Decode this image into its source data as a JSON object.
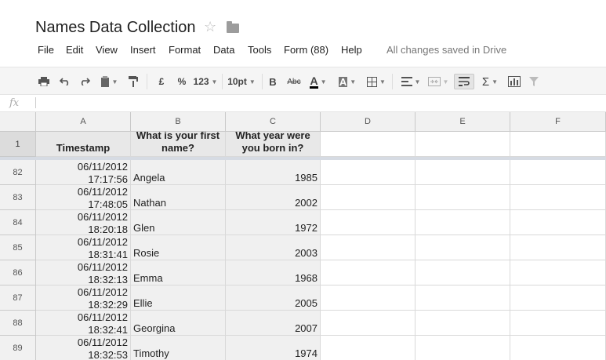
{
  "doc": {
    "title": "Names Data Collection"
  },
  "menu": {
    "items": [
      "File",
      "Edit",
      "View",
      "Insert",
      "Format",
      "Data",
      "Tools",
      "Form (88)",
      "Help"
    ],
    "status": "All changes saved in Drive"
  },
  "toolbar": {
    "currency": "£",
    "percent": "%",
    "number_format": "123",
    "font_size": "10pt",
    "bold": "B",
    "strikethrough": "Abc",
    "text_color": "A",
    "fill_color": "A",
    "sum": "Σ"
  },
  "formula_bar": {
    "fx": "fx",
    "value": ""
  },
  "columns": [
    "A",
    "B",
    "C",
    "D",
    "E",
    "F"
  ],
  "header_row": {
    "row_number": "1",
    "a": "Timestamp",
    "b": "What is your first name?",
    "c": "What year were you born in?"
  },
  "rows": [
    {
      "num": "82",
      "date": "06/11/2012",
      "time": "17:17:56",
      "name": "Angela",
      "year": "1985"
    },
    {
      "num": "83",
      "date": "06/11/2012",
      "time": "17:48:05",
      "name": "Nathan",
      "year": "2002"
    },
    {
      "num": "84",
      "date": "06/11/2012",
      "time": "18:20:18",
      "name": "Glen",
      "year": "1972"
    },
    {
      "num": "85",
      "date": "06/11/2012",
      "time": "18:31:41",
      "name": "Rosie",
      "year": "2003"
    },
    {
      "num": "86",
      "date": "06/11/2012",
      "time": "18:32:13",
      "name": "Emma",
      "year": "1968"
    },
    {
      "num": "87",
      "date": "06/11/2012",
      "time": "18:32:29",
      "name": "Ellie",
      "year": "2005"
    },
    {
      "num": "88",
      "date": "06/11/2012",
      "time": "18:32:41",
      "name": "Georgina",
      "year": "2007"
    },
    {
      "num": "89",
      "date": "06/11/2012",
      "time": "18:32:53",
      "name": "Timothy",
      "year": "1974"
    }
  ]
}
